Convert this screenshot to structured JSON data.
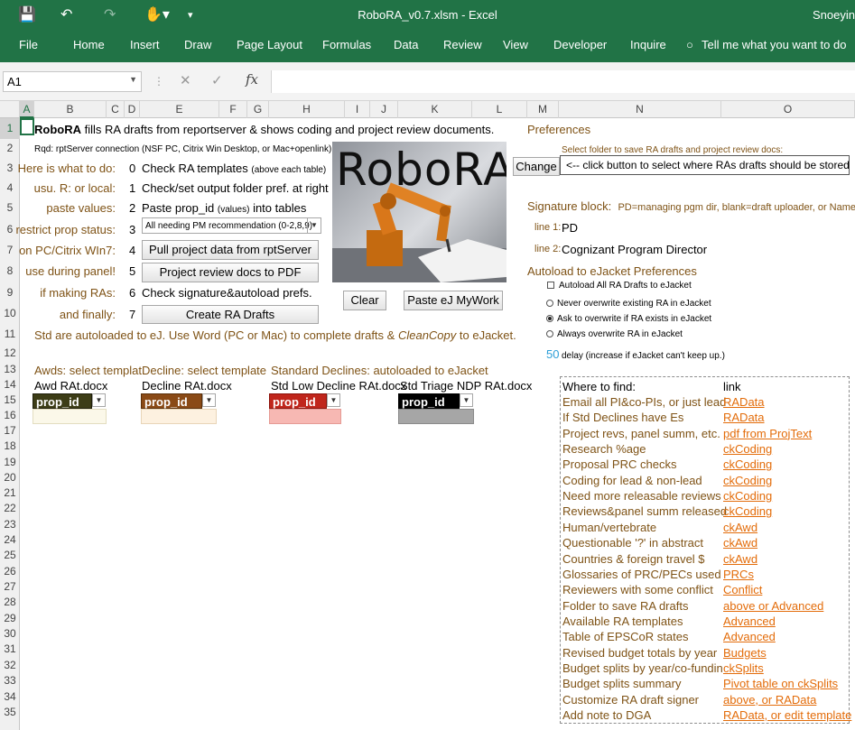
{
  "app": {
    "title": "RoboRA_v0.7.xlsm - Excel",
    "user": "Snoeyin"
  },
  "ribbon": {
    "tabs": [
      "File",
      "Home",
      "Insert",
      "Draw",
      "Page Layout",
      "Formulas",
      "Data",
      "Review",
      "View",
      "Developer",
      "Inquire"
    ],
    "tell_me": "Tell me what you want to do"
  },
  "formula_bar": {
    "name_box": "A1",
    "fx": "fx",
    "value": ""
  },
  "columns": [
    "A",
    "B",
    "C",
    "D",
    "E",
    "F",
    "G",
    "H",
    "I",
    "J",
    "K",
    "L",
    "M",
    "N",
    "O"
  ],
  "rows": [
    "1",
    "2",
    "3",
    "4",
    "5",
    "6",
    "7",
    "8",
    "9",
    "10",
    "11",
    "12",
    "13",
    "14",
    "15",
    "16",
    "17",
    "18",
    "19",
    "20",
    "21",
    "22",
    "23",
    "24",
    "25",
    "26",
    "27",
    "28",
    "29",
    "30",
    "31",
    "32",
    "33",
    "34",
    "35"
  ],
  "sheet": {
    "r1_bold": "RoboRA",
    "r1_rest": " fills RA drafts from reportserver & shows coding and project review documents.",
    "r2": "Rqd: rptServer connection (NSF PC, Citrix Win Desktop, or Mac+openlink)",
    "steps_left": [
      "Here is what to do:",
      "usu. R: or local:",
      "paste values:",
      "restrict prop status:",
      "on PC/Citrix WIn7:",
      "use during panel!",
      "if making RAs:",
      "and finally:"
    ],
    "steps_num": [
      "0",
      "1",
      "2",
      "3",
      "4",
      "5",
      "6",
      "7"
    ],
    "step0_a": "Check RA templates",
    "step0_b": "(above each table)",
    "step1": "Check/set output folder pref. at right",
    "step2_a": "Paste prop_id",
    "step2_b": "(values)",
    "step2_c": "into tables",
    "status_select": "All needing PM recommendation (0-2,8,9)",
    "btn_pull": "Pull project data from rptServer",
    "btn_pdf": "Project review docs to PDF",
    "step6": "Check signature&autoload prefs.",
    "btn_create": "Create RA Drafts",
    "btn_clear": "Clear",
    "btn_paste": "Paste eJ MyWork",
    "logo_text": "RoboRA",
    "r11_a": "Std are autoloaded to eJ. Use Word (PC or Mac) to complete drafts & ",
    "r11_b": "CleanCopy",
    "r11_c": " to eJacket.",
    "r13_a": "Awds: select templat",
    "r13_b": "Decline: select template",
    "r13_c": "Standard Declines: autoloaded to eJacket",
    "templates": [
      "Awd RAt.docx",
      "Decline RAt.docx",
      "Std Low Decline RAt.docx",
      "Std Triage NDP RAt.docx"
    ],
    "pid": "prop_id",
    "prefs": "Preferences",
    "folder_hint": "Select folder to save RA drafts and project review docs:",
    "btn_change": "Change",
    "folder_value": "<-- click button to select where RAs drafts should be stored",
    "sig_label": "Signature block:",
    "sig_hint": "PD=managing pgm dir, blank=draft uploader, or Name T",
    "line1_label": "line 1:",
    "line1_value": "PD",
    "line2_label": "line 2:",
    "line2_value": "Cognizant Program Director",
    "autoload_title": "Autoload to eJacket Preferences",
    "autoload_all": "Autoload All RA Drafts to eJacket",
    "radio_never": "Never overwrite existing RA in eJacket",
    "radio_ask": "Ask to overwrite if RA exists in eJacket",
    "radio_always": "Always overwrite RA in eJacket",
    "delay_value": "50",
    "delay_label": "delay (increase if eJacket can't keep up.)"
  },
  "find": {
    "header_where": "Where to find:",
    "header_link": "link",
    "items": [
      {
        "where": "Email all PI&co-PIs, or just lead",
        "link": "RAData"
      },
      {
        "where": "If Std Declines have Es",
        "link": "RAData"
      },
      {
        "where": "Project revs, panel summ, etc.",
        "link": "pdf from ProjText"
      },
      {
        "where": "Research %age",
        "link": "ckCoding"
      },
      {
        "where": "Proposal PRC checks",
        "link": "ckCoding"
      },
      {
        "where": "Coding for lead & non-lead",
        "link": "ckCoding"
      },
      {
        "where": "Need more releasable reviews",
        "link": "ckCoding"
      },
      {
        "where": "Reviews&panel summ released",
        "link": "ckCoding"
      },
      {
        "where": "Human/vertebrate",
        "link": "ckAwd"
      },
      {
        "where": "Questionable '?' in abstract",
        "link": "ckAwd"
      },
      {
        "where": "Countries & foreign travel $",
        "link": "ckAwd"
      },
      {
        "where": "Glossaries of PRC/PECs used",
        "link": "PRCs"
      },
      {
        "where": "Reviewers with some conflict",
        "link": "Conflict"
      },
      {
        "where": "Folder to save RA drafts",
        "link": "above or Advanced"
      },
      {
        "where": "Available RA templates",
        "link": "Advanced"
      },
      {
        "where": "Table of EPSCoR states",
        "link": "Advanced"
      },
      {
        "where": "Revised budget totals by year",
        "link": "Budgets"
      },
      {
        "where": "Budget splits by year/co-fundin",
        "link": "ckSplits"
      },
      {
        "where": "Budget splits summary",
        "link": "Pivot table on ckSplits"
      },
      {
        "where": "Customize RA draft signer",
        "link": "above, or RAData"
      },
      {
        "where": "Add note to DGA",
        "link": "RAData, or edit template"
      }
    ]
  },
  "colors": {
    "excel_green": "#217346",
    "label_brown": "#7f5316",
    "link_orange": "#e36c0a",
    "delay_blue": "#2e9fd8"
  }
}
